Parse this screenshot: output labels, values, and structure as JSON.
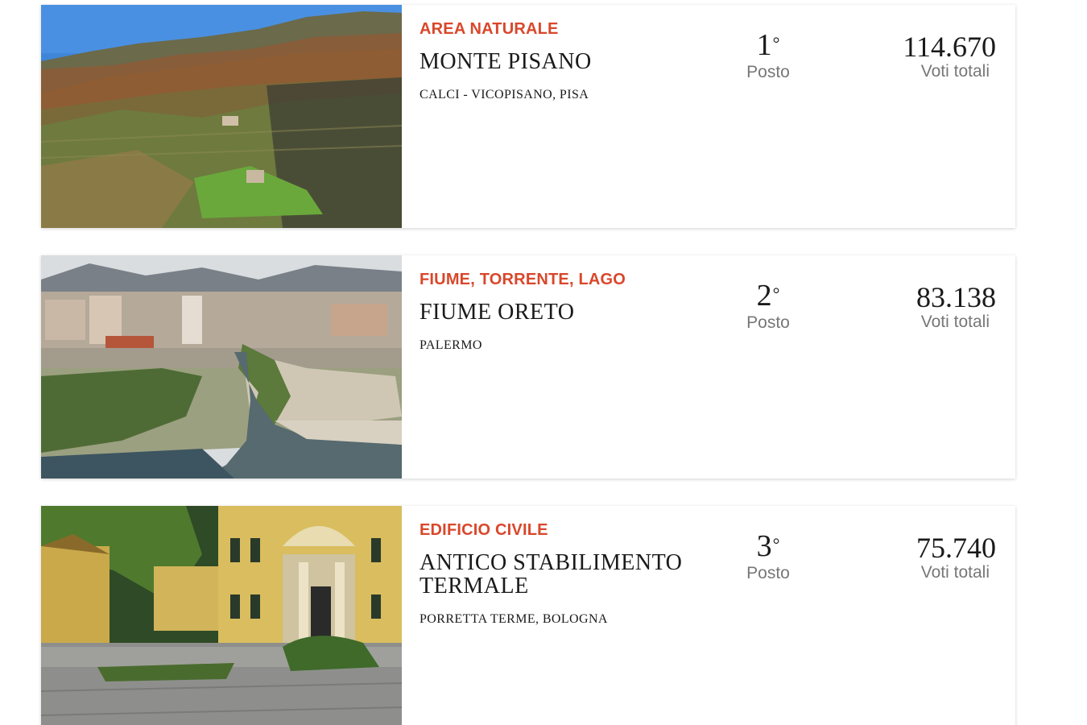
{
  "colors": {
    "category": "#d9472b",
    "text": "#1a1a1a",
    "muted": "#777777"
  },
  "entries": [
    {
      "category": "AREA NATURALE",
      "title": "MONTE PISANO",
      "location": "CALCI - VICOPISANO, PISA",
      "rank": "1",
      "rank_suffix": "°",
      "rank_label": "Posto",
      "votes": "114.670",
      "votes_label": "Voti totali"
    },
    {
      "category": "FIUME, TORRENTE, LAGO",
      "title": "FIUME ORETO",
      "location": "PALERMO",
      "rank": "2",
      "rank_suffix": "°",
      "rank_label": "Posto",
      "votes": "83.138",
      "votes_label": "Voti totali"
    },
    {
      "category": "EDIFICIO CIVILE",
      "title": "ANTICO STABILIMENTO TERMALE",
      "location": "PORRETTA TERME, BOLOGNA",
      "rank": "3",
      "rank_suffix": "°",
      "rank_label": "Posto",
      "votes": "75.740",
      "votes_label": "Voti totali"
    }
  ]
}
